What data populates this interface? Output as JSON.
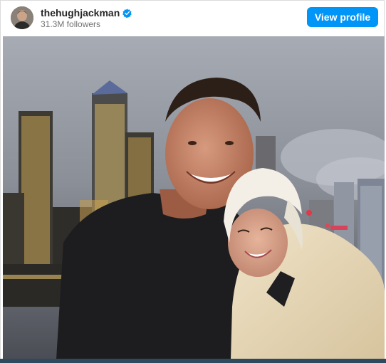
{
  "post": {
    "username": "thehughjackman",
    "followers": "31.3M followers",
    "view_profile_label": "View profile"
  },
  "icons": {
    "verified": "verified-badge-icon"
  },
  "colors": {
    "accent": "#0095f6",
    "username": "#262626",
    "secondary_text": "#737373"
  }
}
